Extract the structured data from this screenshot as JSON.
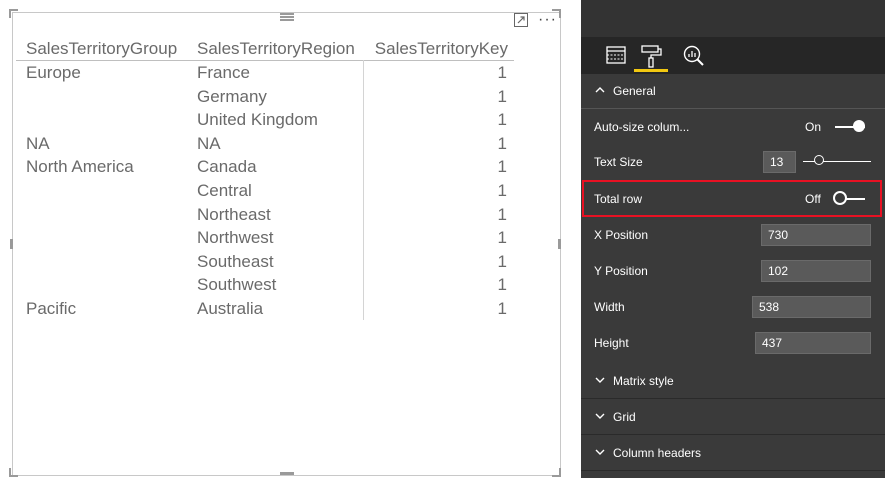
{
  "matrix": {
    "headers": [
      "SalesTerritoryGroup",
      "SalesTerritoryRegion",
      "SalesTerritoryKey"
    ],
    "rows": [
      {
        "group": "Europe",
        "region": "France",
        "key": "1"
      },
      {
        "group": "",
        "region": "Germany",
        "key": "1"
      },
      {
        "group": "",
        "region": "United Kingdom",
        "key": "1"
      },
      {
        "group": "NA",
        "region": "NA",
        "key": "1"
      },
      {
        "group": "North America",
        "region": "Canada",
        "key": "1"
      },
      {
        "group": "",
        "region": "Central",
        "key": "1"
      },
      {
        "group": "",
        "region": "Northeast",
        "key": "1"
      },
      {
        "group": "",
        "region": "Northwest",
        "key": "1"
      },
      {
        "group": "",
        "region": "Southeast",
        "key": "1"
      },
      {
        "group": "",
        "region": "Southwest",
        "key": "1"
      },
      {
        "group": "Pacific",
        "region": "Australia",
        "key": "1"
      }
    ]
  },
  "visual_header": {
    "focus_icon": "focus-mode-icon",
    "more_icon": "more-options-icon",
    "more_glyph": "···"
  },
  "format_pane": {
    "tabs": [
      {
        "name": "fields",
        "icon": "fields-icon",
        "active": false
      },
      {
        "name": "format",
        "icon": "paint-roller-icon",
        "active": true
      },
      {
        "name": "analytics",
        "icon": "analytics-icon",
        "active": false
      }
    ],
    "general": {
      "label": "General",
      "expanded": true,
      "autosize": {
        "label": "Auto-size colum...",
        "state": "On"
      },
      "text_size": {
        "label": "Text Size",
        "value": "13"
      },
      "total_row": {
        "label": "Total row",
        "state": "Off"
      },
      "x_position": {
        "label": "X Position",
        "value": "730"
      },
      "y_position": {
        "label": "Y Position",
        "value": "102"
      },
      "width": {
        "label": "Width",
        "value": "538"
      },
      "height": {
        "label": "Height",
        "value": "437"
      }
    },
    "sections": {
      "matrix_style": "Matrix style",
      "grid": "Grid",
      "column_headers": "Column headers"
    }
  },
  "colors": {
    "pane_background": "#3a3a3a",
    "tab_bar": "#262626",
    "active_tab_accent": "#f2c811",
    "highlight_border": "#e81123",
    "table_text": "#6a6a6a"
  }
}
